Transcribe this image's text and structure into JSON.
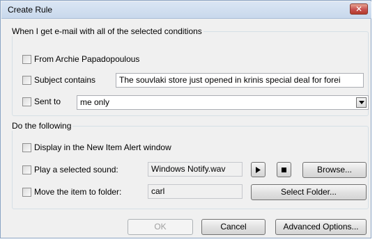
{
  "window": {
    "title": "Create Rule",
    "close_glyph": "✕"
  },
  "conditions": {
    "legend": "When I get e-mail with all of the selected conditions",
    "from_label": "From Archie Papadopoulous",
    "subject_label": "Subject contains",
    "subject_value": "The souvlaki store just opened in krinis special deal for forei",
    "sent_to_label": "Sent to",
    "sent_to_value": "me only"
  },
  "actions": {
    "legend": "Do the following",
    "display_label": "Display in the New Item Alert window",
    "sound_label": "Play a selected sound:",
    "sound_value": "Windows Notify.wav",
    "browse_label": "Browse...",
    "move_label": "Move the item to folder:",
    "folder_value": "carl",
    "select_folder_label": "Select Folder..."
  },
  "footer": {
    "ok_label": "OK",
    "cancel_label": "Cancel",
    "advanced_label": "Advanced Options..."
  },
  "colors": {
    "title_bar": "#c8d8ec",
    "close_button": "#c75050",
    "dialog_bg": "#f0f0f0"
  }
}
